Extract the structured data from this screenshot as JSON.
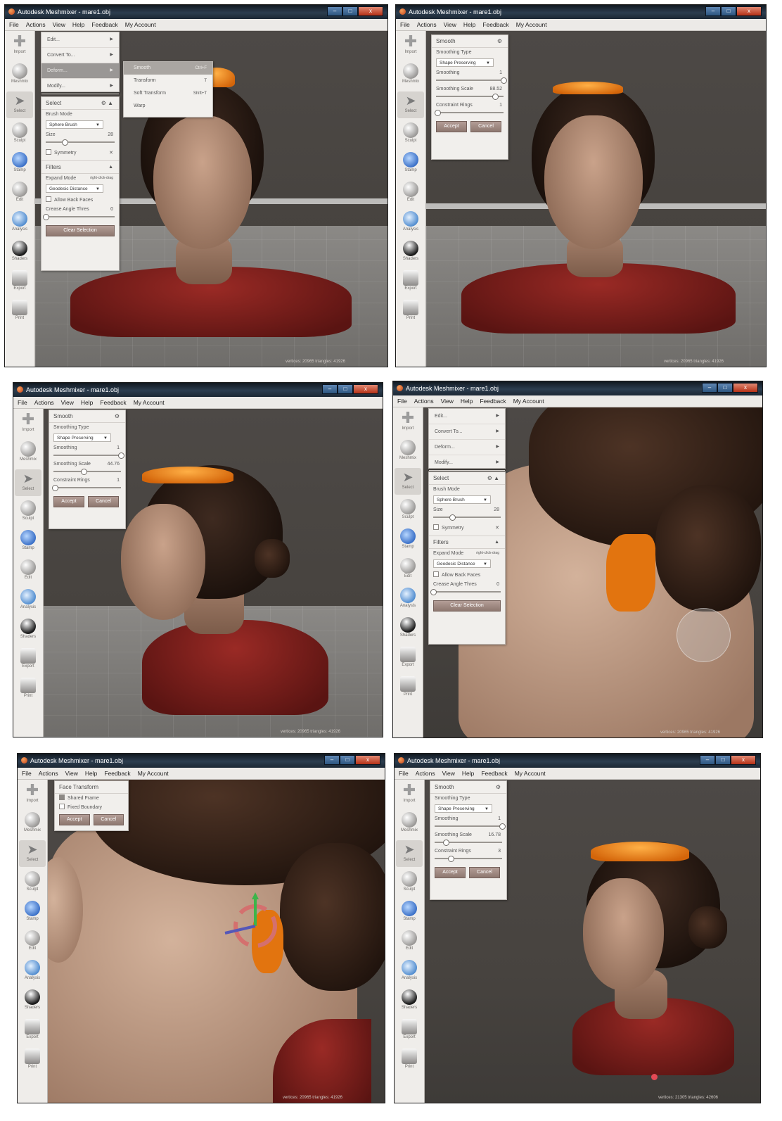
{
  "app": {
    "title": "Autodesk Meshmixer - mare1.obj",
    "window_buttons": {
      "minimize": "–",
      "maximize": "□",
      "close": "x"
    }
  },
  "menu": [
    "File",
    "Actions",
    "View",
    "Help",
    "Feedback",
    "My Account"
  ],
  "tools": [
    {
      "label": "Import",
      "icon": "plus-icon"
    },
    {
      "label": "Meshmix",
      "icon": "sphere-icon"
    },
    {
      "label": "Select",
      "icon": "arrow-icon"
    },
    {
      "label": "Sculpt",
      "icon": "brush-icon"
    },
    {
      "label": "Stamp",
      "icon": "stamp-icon"
    },
    {
      "label": "Edit",
      "icon": "edit-icon"
    },
    {
      "label": "Analysis",
      "icon": "analysis-icon"
    },
    {
      "label": "Shaders",
      "icon": "shader-icon"
    },
    {
      "label": "Export",
      "icon": "export-icon"
    },
    {
      "label": "Print",
      "icon": "print-icon"
    }
  ],
  "edit_menu": {
    "items": [
      "Edit...",
      "Convert To...",
      "Deform...",
      "Modify..."
    ]
  },
  "deform_flyout": [
    {
      "label": "Smooth",
      "shortcut": "Ctrl+F"
    },
    {
      "label": "Transform",
      "shortcut": "T"
    },
    {
      "label": "Soft Transform",
      "shortcut": "Shift+T"
    },
    {
      "label": "Warp",
      "shortcut": ""
    }
  ],
  "select_panel": {
    "title": "Select",
    "brush_mode_label": "Brush Mode",
    "brush_mode_value": "Sphere Brush",
    "size_label": "Size",
    "size_value": "28",
    "size_fraction": 0.28,
    "symmetry_label": "Symmetry",
    "filters_title": "Filters",
    "expand_mode_label": "Expand Mode",
    "expand_mode_hint": "right-click-drag",
    "expand_mode_value": "Geodesic Distance",
    "allow_back_faces_label": "Allow Back Faces",
    "crease_label": "Crease Angle Thres",
    "crease_value": "0",
    "crease_fraction": 0.0,
    "clear_button": "Clear Selection"
  },
  "smooth_panel": {
    "title": "Smooth",
    "type_label": "Smoothing Type",
    "type_value": "Shape Preserving",
    "smoothing_label": "Smoothing",
    "scale_label": "Smoothing Scale",
    "rings_label": "Constraint Rings",
    "accept": "Accept",
    "cancel": "Cancel"
  },
  "smooth_states": [
    {
      "smoothing": "1",
      "smoothing_fraction": 1.0,
      "scale": "88.52",
      "scale_fraction": 0.88,
      "rings": "1",
      "rings_fraction": 0.02
    },
    {
      "smoothing": "1",
      "smoothing_fraction": 1.0,
      "scale": "44.76",
      "scale_fraction": 0.45,
      "rings": "1",
      "rings_fraction": 0.02
    },
    {
      "smoothing": "1",
      "smoothing_fraction": 1.0,
      "scale": "16.78",
      "scale_fraction": 0.17,
      "rings": "3",
      "rings_fraction": 0.24
    }
  ],
  "face_transform": {
    "title": "Face Transform",
    "shared_frame": "Shared Frame",
    "fixed_boundary": "Fixed Boundary",
    "accept": "Accept",
    "cancel": "Cancel"
  },
  "status": {
    "a": "vertices: 20965 triangles: 41926",
    "b": "vertices: 21305 triangles: 42606"
  },
  "colors": {
    "selection_orange": "#e2740f",
    "shirt_red": "#8a1f1c",
    "viewport_bg": "#4a4643"
  }
}
